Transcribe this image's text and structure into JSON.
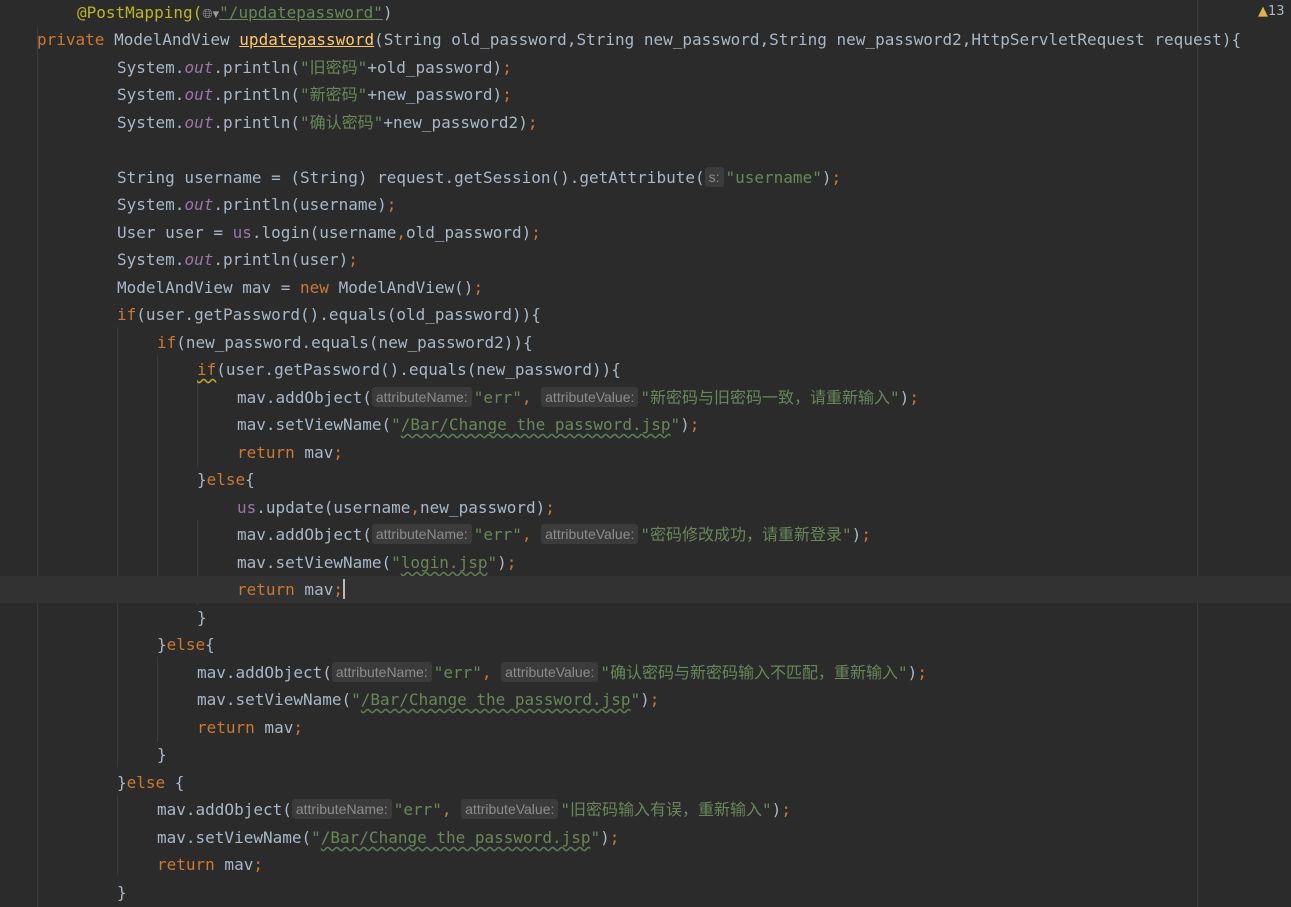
{
  "editor": {
    "language": "java",
    "warning_count": "13",
    "warning_icon": "warning-triangle-icon",
    "inlay_hint_prefix": "s:",
    "inlay_hint_name": "attributeName:",
    "inlay_hint_value": "attributeValue:",
    "colors": {
      "background": "#2b2b2b",
      "keyword": "#cc7832",
      "string": "#6a8759",
      "annotation": "#bbb529",
      "method_declaration": "#ffc66d",
      "field": "#9876aa",
      "text": "#a9b7c6"
    }
  },
  "code": {
    "l1_annotation": "@PostMapping(",
    "l1_url": "\"/updatepassword\"",
    "l1_close": ")",
    "l2_private": "private",
    "l2_type": " ModelAndView ",
    "l2_method": "updatepassword",
    "l2_params": "(String old_password,String new_password,String new_password2,HttpServletRequest request){",
    "sys": "System.",
    "out": "out",
    "println": ".println(",
    "l3_str": "\"旧密码\"",
    "l3_rest": "+old_password)",
    "l4_str": "\"新密码\"",
    "l4_rest": "+new_password)",
    "l5_str": "\"确认密码\"",
    "l5_rest": "+new_password2)",
    "semi": ";",
    "l7_code": "String username = (String) request.getSession().getAttribute(",
    "l7_str": "\"username\"",
    "l7_close": ")",
    "l8_rest": "username)",
    "l9_a": "User user = ",
    "l9_us": "us",
    "l9_b": ".login(username",
    "comma": ",",
    "l9_c": "old_password)",
    "l10_rest": "user)",
    "l11_a": "ModelAndView mav = ",
    "l11_new": "new",
    "l11_b": " ModelAndView()",
    "kw_if": "if",
    "l12_rest": "(user.getPassword().equals(old_password)){",
    "l13_rest": "(new_password.equals(new_password2)){",
    "l14_rest": "(user.getPassword().equals(new_password)){",
    "add_object": "mav.addObject(",
    "err_str": "\"err\"",
    "l15_msg": "\"新密码与旧密码一致，请重新输入\"",
    "close_paren": ")",
    "set_view": "mav.setViewName(",
    "quote": "\"",
    "path_change": "/Bar/Change the password.jsp",
    "kw_return": "return",
    "mav_word": " mav",
    "close_brace": "}",
    "kw_else": "else",
    "open_brace": "{",
    "else_space_brace": " {",
    "l19_update": ".update(username",
    "l19_rest": "new_password)",
    "l20_msg": "\"密码修改成功，请重新登录\"",
    "path_login": "login.jsp",
    "l25_msg": "\"确认密码与新密码输入不匹配，重新输入\"",
    "l30_msg": "\"旧密码输入有误，重新输入\""
  }
}
